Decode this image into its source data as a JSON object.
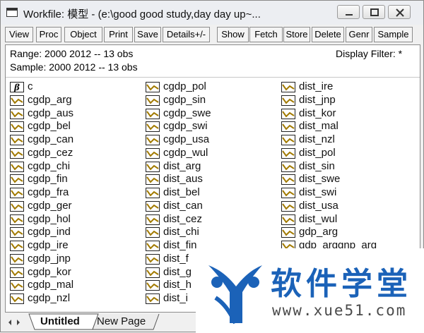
{
  "window": {
    "title": "Workfile: 模型 - (e:\\good good study,day day up~..."
  },
  "toolbar": [
    "View",
    "Proc",
    "Object",
    "Print",
    "Save",
    "Details+/-",
    "Show",
    "Fetch",
    "Store",
    "Delete",
    "Genr",
    "Sample"
  ],
  "info": {
    "range": "Range:  2000 2012   --   13 obs",
    "sample": "Sample: 2000 2012   --   13 obs",
    "filter": "Display Filter: *"
  },
  "columns": [
    [
      "c",
      "cgdp_arg",
      "cgdp_aus",
      "cgdp_bel",
      "cgdp_can",
      "cgdp_cez",
      "cgdp_chi",
      "cgdp_fin",
      "cgdp_fra",
      "cgdp_ger",
      "cgdp_hol",
      "cgdp_ind",
      "cgdp_ire",
      "cgdp_jnp",
      "cgdp_kor",
      "cgdp_mal",
      "cgdp_nzl"
    ],
    [
      "cgdp_pol",
      "cgdp_sin",
      "cgdp_swe",
      "cgdp_swi",
      "cgdp_usa",
      "cgdp_wul",
      "dist_arg",
      "dist_aus",
      "dist_bel",
      "dist_can",
      "dist_cez",
      "dist_chi",
      "dist_fin",
      "dist_f",
      "dist_g",
      "dist_h",
      "dist_i"
    ],
    [
      "dist_ire",
      "dist_jnp",
      "dist_kor",
      "dist_mal",
      "dist_nzl",
      "dist_pol",
      "dist_sin",
      "dist_swe",
      "dist_swi",
      "dist_usa",
      "dist_wul",
      "gdp_arg",
      "gdp_arggnp_arg"
    ]
  ],
  "tabs": [
    "Untitled",
    "New Page"
  ],
  "watermark": {
    "name": "软件学堂",
    "url": "www.xue51.com"
  }
}
